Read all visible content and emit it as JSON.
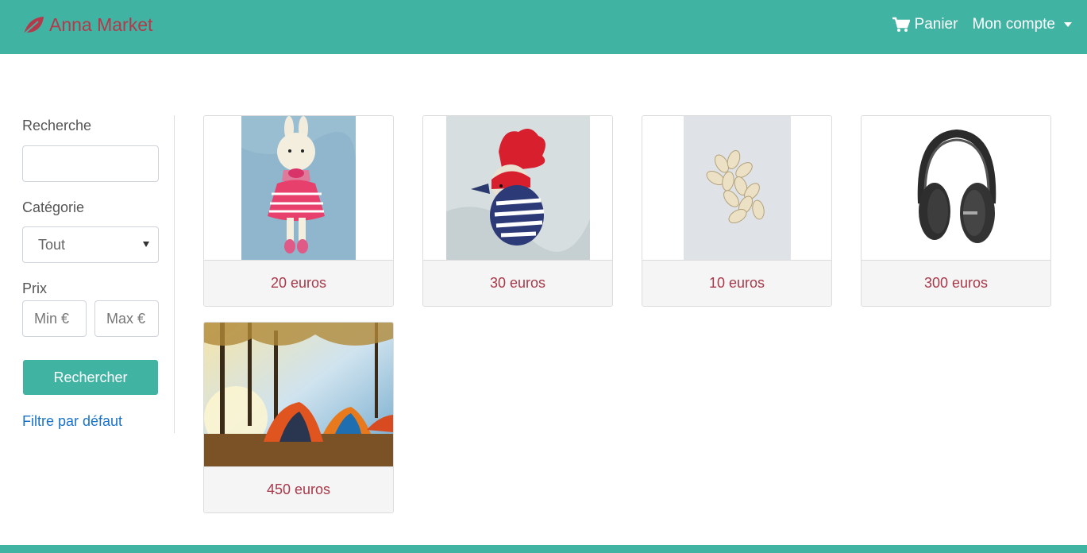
{
  "navbar": {
    "brand": "Anna Market",
    "cart_label": "Panier",
    "account_label": "Mon compte",
    "colors": {
      "bar": "#41b3a3",
      "brand": "#b5394a"
    }
  },
  "filters": {
    "search_label": "Recherche",
    "search_value": "",
    "category_label": "Catégorie",
    "category_value": "Tout",
    "price_label": "Prix",
    "min_placeholder": "Min €",
    "max_placeholder": "Max €",
    "search_button": "Rechercher",
    "reset_link": "Filtre par défaut"
  },
  "products": [
    {
      "price": "20 euros",
      "image": "crochet-bunny-image"
    },
    {
      "price": "30 euros",
      "image": "crochet-bird-image"
    },
    {
      "price": "10 euros",
      "image": "pumpkin-seeds-image"
    },
    {
      "price": "300 euros",
      "image": "headphones-image"
    },
    {
      "price": "450 euros",
      "image": "tents-forest-image"
    }
  ]
}
